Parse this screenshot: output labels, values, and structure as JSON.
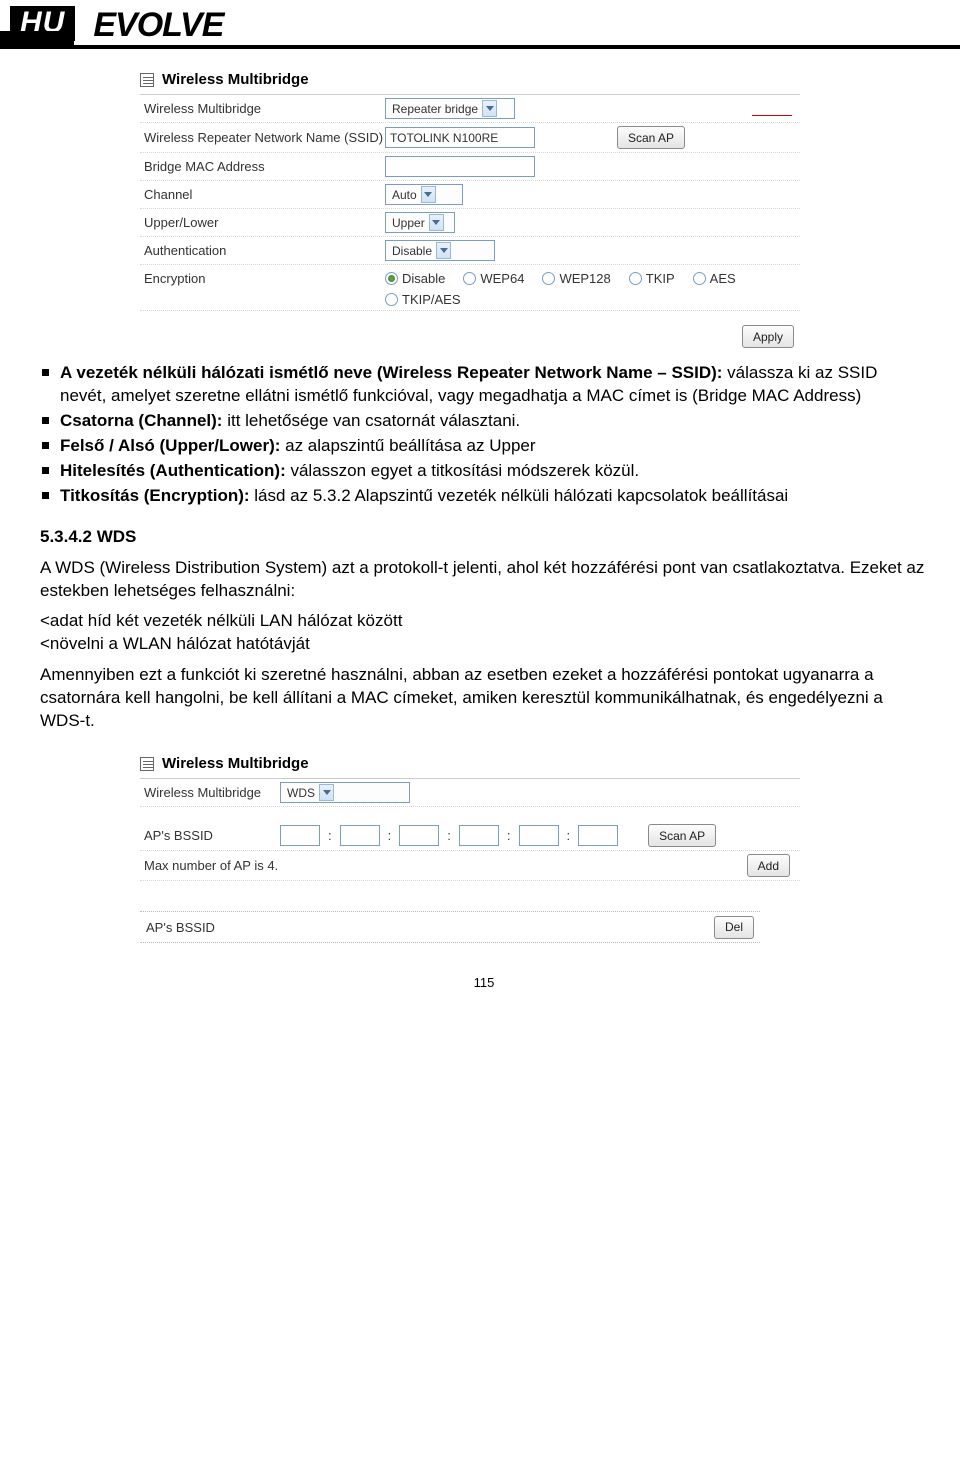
{
  "header": {
    "badge": "HU",
    "brand": "EVOLVE"
  },
  "panel1": {
    "title": "Wireless Multibridge",
    "rows": {
      "multibridge_label": "Wireless Multibridge",
      "multibridge_value": "Repeater bridge",
      "ssid_label": "Wireless Repeater Network Name (SSID)",
      "ssid_value": "TOTOLINK N100RE",
      "scan_btn": "Scan AP",
      "mac_label": "Bridge MAC Address",
      "channel_label": "Channel",
      "channel_value": "Auto",
      "upperlower_label": "Upper/Lower",
      "upperlower_value": "Upper",
      "auth_label": "Authentication",
      "auth_value": "Disable",
      "enc_label": "Encryption",
      "enc_opts": {
        "disable": "Disable",
        "wep64": "WEP64",
        "wep128": "WEP128",
        "tkip": "TKIP",
        "aes": "AES",
        "tkipaes": "TKIP/AES"
      },
      "apply_btn": "Apply"
    }
  },
  "doc": {
    "b1_lead": "A vezeték nélküli hálózati ismétlő neve (Wireless Repeater Network Name – SSID):",
    "b1_rest": " válassza ki az SSID nevét, amelyet szeretne ellátni ismétlő funkcióval, vagy megadhatja a MAC címet is (Bridge MAC Address)",
    "b2_lead": "Csatorna (Channel):",
    "b2_rest": " itt lehetősége van csatornát választani.",
    "b3_lead": "Felső / Alsó (Upper/Lower):",
    "b3_rest": " az alapszintű beállítása az Upper",
    "b4_lead": "Hitelesítés (Authentication):",
    "b4_rest": " válasszon egyet a titkosítási módszerek közül.",
    "b5_lead": "Titkosítás (Encryption):",
    "b5_rest": " lásd az 5.3.2 Alapszintű vezeték nélküli hálózati kapcsolatok beállításai",
    "sec_title": "5.3.4.2 WDS",
    "p1": "A WDS (Wireless Distribution System) azt a protokoll-t jelenti, ahol két hozzáférési pont van csatlakoztatva. Ezeket az estekben lehetséges felhasználni:",
    "l1": "<adat híd két vezeték nélküli LAN hálózat között",
    "l2": "<növelni a WLAN hálózat hatótávját",
    "p2": "Amennyiben ezt a funkciót ki szeretné használni, abban az esetben ezeket a hozzáférési pontokat ugyanarra a csatornára kell hangolni, be kell állítani a MAC címeket, amiken keresztül kommunikálhatnak, és engedélyezni a WDS-t."
  },
  "panel2": {
    "title": "Wireless Multibridge",
    "rows": {
      "multibridge_label": "Wireless Multibridge",
      "multibridge_value": "WDS",
      "bssid_label": "AP's BSSID",
      "scan_btn": "Scan AP",
      "max_label": "Max number of AP is 4.",
      "add_btn": "Add",
      "ap_bssid_col": "AP's BSSID",
      "del_btn": "Del"
    }
  },
  "page_number": "115"
}
